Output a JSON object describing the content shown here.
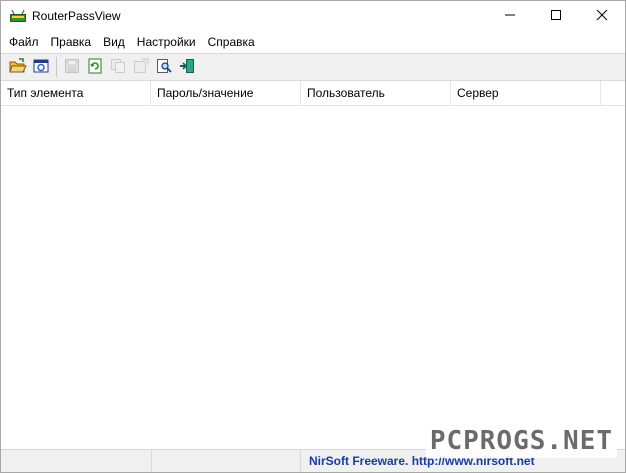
{
  "window": {
    "title": "RouterPassView",
    "controls": [
      "minimize-icon",
      "maximize-icon",
      "close-icon"
    ]
  },
  "menu": {
    "items": [
      {
        "label": "Файл"
      },
      {
        "label": "Правка"
      },
      {
        "label": "Вид"
      },
      {
        "label": "Настройки"
      },
      {
        "label": "Справка"
      }
    ]
  },
  "toolbar": {
    "buttons": [
      {
        "icon": "open-folder-icon",
        "enabled": true
      },
      {
        "icon": "open-browser-icon",
        "enabled": true
      },
      {
        "icon": "save-icon",
        "enabled": false
      },
      {
        "icon": "refresh-icon",
        "enabled": true
      },
      {
        "icon": "copy-icon",
        "enabled": false
      },
      {
        "icon": "properties-icon",
        "enabled": false
      },
      {
        "icon": "find-icon",
        "enabled": true
      },
      {
        "icon": "exit-icon",
        "enabled": true
      }
    ]
  },
  "list": {
    "columns": [
      "Тип элемента",
      "Пароль/значение",
      "Пользователь",
      "Сервер"
    ],
    "rows": []
  },
  "status": {
    "link": "NirSoft Freeware.  http://www.nirsoft.net"
  },
  "watermark": "PCPROGS.NET",
  "colors": {
    "link": "#1a3aa0",
    "toolbar_bg": "#f0f0f0"
  }
}
